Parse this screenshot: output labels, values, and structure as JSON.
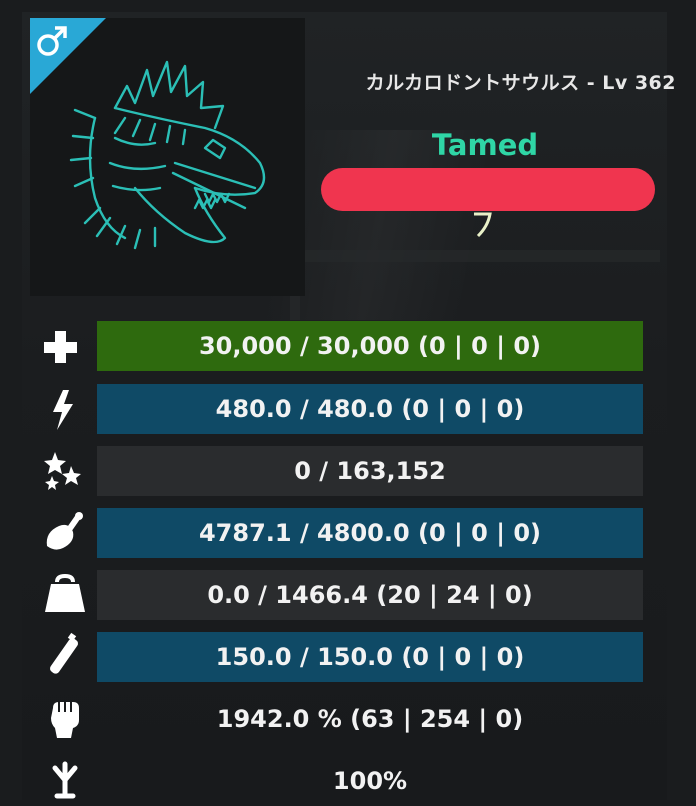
{
  "creature": {
    "gender_icon": "male-icon",
    "name_level": "カルカロドントサウルス - Lv 362",
    "status": "Tamed",
    "accent_color": "#2fd6a6"
  },
  "stats": [
    {
      "icon": "health-plus-icon",
      "value": "30,000 / 30,000 (0 | 0 | 0)",
      "bar_color": "#2e6a0e"
    },
    {
      "icon": "stamina-bolt-icon",
      "value": "480.0 / 480.0 (0 | 0 | 0)",
      "bar_color": "#0f4a66"
    },
    {
      "icon": "torpidity-stars-icon",
      "value": "0 / 163,152",
      "bar_color": "#2a2c2e"
    },
    {
      "icon": "food-drumstick-icon",
      "value": "4787.1 / 4800.0 (0 | 0 | 0)",
      "bar_color": "#0f4a66"
    },
    {
      "icon": "weight-icon",
      "value": "0.0 / 1466.4 (20 | 24 | 0)",
      "bar_color": "#2a2c2e"
    },
    {
      "icon": "oxygen-tank-icon",
      "value": "150.0 / 150.0 (0 | 0 | 0)",
      "bar_color": "#0f4a66"
    },
    {
      "icon": "melee-fist-icon",
      "value": "1942.0 % (63 | 254 | 0)",
      "bar_color": "none"
    },
    {
      "icon": "speed-foot-icon",
      "value": "100%",
      "bar_color": "none"
    }
  ]
}
